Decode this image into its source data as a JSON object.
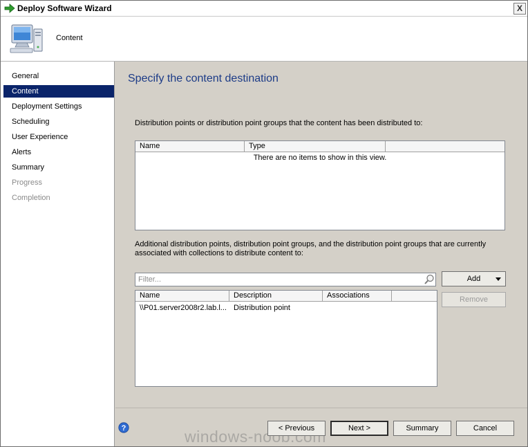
{
  "window": {
    "title": "Deploy Software Wizard",
    "close_label": "X"
  },
  "header": {
    "title": "Content"
  },
  "sidebar": {
    "items": [
      {
        "label": "General"
      },
      {
        "label": "Content"
      },
      {
        "label": "Deployment Settings"
      },
      {
        "label": "Scheduling"
      },
      {
        "label": "User Experience"
      },
      {
        "label": "Alerts"
      },
      {
        "label": "Summary"
      },
      {
        "label": "Progress"
      },
      {
        "label": "Completion"
      }
    ],
    "active_index": 1
  },
  "main": {
    "title": "Specify the content destination",
    "distributed_desc": "Distribution points or distribution point groups that the content has been distributed to:",
    "distributed_list": {
      "columns": [
        "Name",
        "Type"
      ],
      "empty_text": "There are no items to show in this view."
    },
    "additional_desc": "Additional distribution points, distribution point groups, and the distribution point groups that are currently associated with collections to distribute content to:",
    "filter_placeholder": "Filter...",
    "additional_list": {
      "columns": [
        "Name",
        "Description",
        "Associations"
      ],
      "rows": [
        {
          "name": "\\\\P01.server2008r2.lab.l...",
          "description": "Distribution point",
          "associations": ""
        }
      ]
    },
    "add_label": "Add",
    "remove_label": "Remove"
  },
  "footer": {
    "previous_label": "< Previous",
    "next_label": "Next >",
    "summary_label": "Summary",
    "cancel_label": "Cancel",
    "watermark": "windows-noob.com"
  },
  "colors": {
    "accent_selection": "#0a246a",
    "title_blue": "#1c3b87",
    "dialog_bg": "#d4d0c8"
  }
}
